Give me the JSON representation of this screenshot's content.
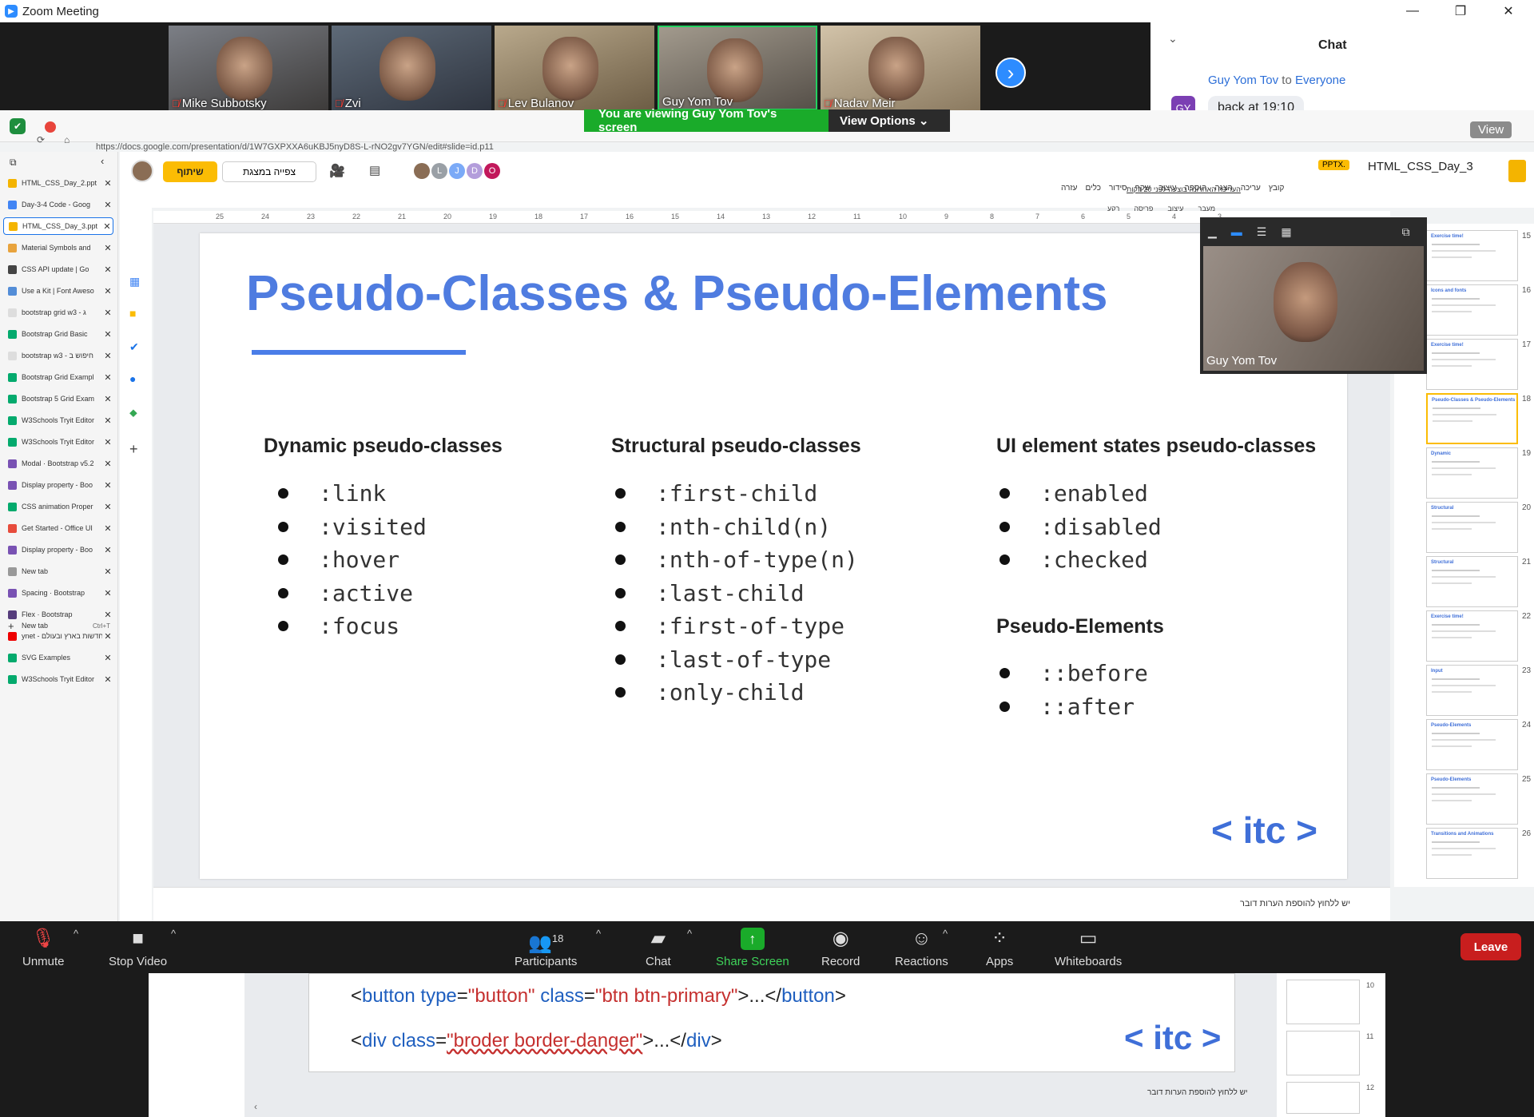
{
  "window": {
    "title": "Zoom Meeting",
    "minimize": "—",
    "restore": "❐",
    "close": "✕"
  },
  "participants_strip": [
    {
      "name": "Mike Subbotsky",
      "muted": true
    },
    {
      "name": "Zvi",
      "muted": true
    },
    {
      "name": "Lev Bulanov",
      "muted": true
    },
    {
      "name": "Guy Yom Tov",
      "muted": false
    },
    {
      "name": "Nadav Meir",
      "muted": true
    }
  ],
  "strip_next": "›",
  "chat": {
    "title": "Chat",
    "from": "Guy Yom Tov",
    "to_word": "to",
    "to": "Everyone",
    "avatar": "GY",
    "message": "back at 19:10"
  },
  "share_banner": {
    "text": "You are viewing Guy Yom Tov's screen",
    "options": "View Options ⌄"
  },
  "browser": {
    "url": "https://docs.google.com/presentation/d/1W7GXPXXA6uKBJ5nyD8S-L-rNO2gv7YGN/edit#slide=id.p11",
    "view_label": "View"
  },
  "tabs": [
    {
      "title": "HTML_CSS_Day_2.ppt",
      "color": "#f4b400"
    },
    {
      "title": "Day-3-4 Code - Goog",
      "color": "#4285f4"
    },
    {
      "title": "HTML_CSS_Day_3.ppt",
      "color": "#f4b400",
      "active": true
    },
    {
      "title": "Material Symbols and",
      "color": "#e8a33d"
    },
    {
      "title": "CSS API update | Go",
      "color": "#444"
    },
    {
      "title": "Use a Kit | Font Aweso",
      "color": "#538dd7"
    },
    {
      "title": "bootstrap grid w3 - ג",
      "color": "#ddd"
    },
    {
      "title": "Bootstrap Grid Basic",
      "color": "#04aa6d"
    },
    {
      "title": "bootstrap w3 - חיפוש ב",
      "color": "#ddd"
    },
    {
      "title": "Bootstrap Grid Exampl",
      "color": "#04aa6d"
    },
    {
      "title": "Bootstrap 5 Grid Exam",
      "color": "#04aa6d"
    },
    {
      "title": "W3Schools Tryit Editor",
      "color": "#04aa6d"
    },
    {
      "title": "W3Schools Tryit Editor",
      "color": "#04aa6d"
    },
    {
      "title": "Modal · Bootstrap v5.2",
      "color": "#7952b3"
    },
    {
      "title": "Display property - Boo",
      "color": "#7952b3"
    },
    {
      "title": "CSS animation Proper",
      "color": "#04aa6d"
    },
    {
      "title": "Get Started - Office UI",
      "color": "#e74c3c"
    },
    {
      "title": "Display property - Boo",
      "color": "#7952b3"
    },
    {
      "title": "New tab",
      "color": "#999"
    },
    {
      "title": "Spacing · Bootstrap",
      "color": "#7952b3"
    },
    {
      "title": "Flex · Bootstrap",
      "color": "#563d7c"
    },
    {
      "title": "ynet - חדשות בארץ ובעולם",
      "color": "#e00"
    },
    {
      "title": "SVG Examples",
      "color": "#04aa6d"
    },
    {
      "title": "W3Schools Tryit Editor",
      "color": "#04aa6d"
    }
  ],
  "new_tab": {
    "label": "New tab",
    "shortcut": "Ctrl+T"
  },
  "slides_app": {
    "doc_title": "HTML_CSS_Day_3",
    "format_badge": "PPTX.",
    "share_button": "שיתוף",
    "present_button": "צפייה במצגת",
    "last_edit": "העריכה האחרונה בוצעה לפני 20 דקות",
    "menu": [
      "קובץ",
      "עריכה",
      "הצגה",
      "הוספה",
      "עיצוב",
      "שקף",
      "סידור",
      "כלים",
      "עזרה"
    ],
    "toolbar_items": [
      "רקע",
      "פריסה",
      "עיצוב",
      "מעבר"
    ],
    "avatars": [
      "L",
      "J",
      "D",
      "O"
    ],
    "ruler_numbers": [
      "25",
      "24",
      "23",
      "22",
      "21",
      "20",
      "19",
      "18",
      "17",
      "16",
      "15",
      "14",
      "13",
      "12",
      "11",
      "10",
      "9",
      "8",
      "7",
      "6",
      "5",
      "4",
      "3"
    ],
    "notes_placeholder": "יש ללחוץ להוספת הערות דובר"
  },
  "slide": {
    "title": "Pseudo-Classes & Pseudo-Elements",
    "columns": [
      {
        "heading": "Dynamic pseudo-classes",
        "items": [
          ":link",
          ":visited",
          ":hover",
          ":active",
          ":focus"
        ]
      },
      {
        "heading": "Structural pseudo-classes",
        "items": [
          ":first-child",
          ":nth-child(n)",
          ":nth-of-type(n)",
          ":last-child",
          ":first-of-type",
          ":last-of-type",
          ":only-child"
        ]
      },
      {
        "heading": "UI element states pseudo-classes",
        "items": [
          ":enabled",
          ":disabled",
          ":checked"
        ]
      },
      {
        "heading": "Pseudo-Elements",
        "items": [
          "::before",
          "::after"
        ]
      }
    ],
    "logo": "< itc >"
  },
  "thumb_numbers": [
    "15",
    "16",
    "17",
    "18",
    "19",
    "20",
    "21",
    "22",
    "23",
    "24",
    "25",
    "26"
  ],
  "thumb_titles": [
    "Exercise time!",
    "Icons and fonts",
    "Exercise time!",
    "Pseudo-Classes & Pseudo-Elements",
    "Dynamic",
    "Structural",
    "Structural",
    "Exercise time!",
    "Input",
    "Pseudo-Elements",
    "Pseudo-Elements",
    "Transitions and Animations"
  ],
  "self_view": {
    "name": "Guy Yom Tov"
  },
  "toolbar": {
    "unmute": "Unmute",
    "stop_video": "Stop Video",
    "participants": "Participants",
    "participants_count": "18",
    "chat": "Chat",
    "share_screen": "Share Screen",
    "record": "Record",
    "reactions": "Reactions",
    "apps": "Apps",
    "whiteboards": "Whiteboards",
    "leave": "Leave"
  },
  "peek": {
    "line1": {
      "open": "<",
      "tag": "button",
      "a1": " type",
      "eq1": "=",
      "v1": "\"button\"",
      "a2": " class",
      "eq2": "=",
      "v2": "\"btn btn-primary\"",
      "close": ">...</",
      "ctag": "button",
      "end": ">"
    },
    "line2": {
      "open": "<",
      "tag": "div",
      "a1": " class",
      "eq1": "=",
      "v1": "\"broder border-danger\"",
      "close": ">...</",
      "ctag": "div",
      "end": ">"
    },
    "logo": "< itc >",
    "notes_placeholder": "יש ללחוץ להוספת הערות דובר",
    "thumb_numbers": [
      "10",
      "11",
      "12"
    ]
  }
}
